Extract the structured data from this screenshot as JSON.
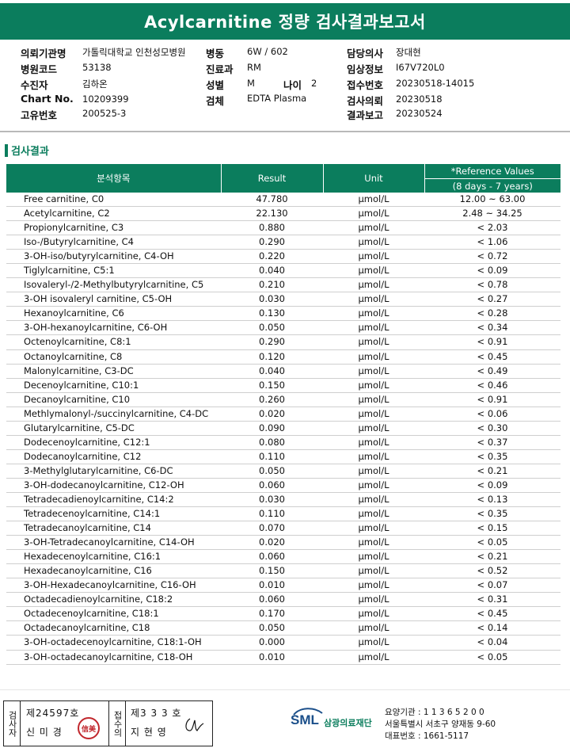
{
  "title": "Acylcarnitine 정량 검사결과보고서",
  "patient_info": [
    {
      "label": "의뢰기관명",
      "value": "가톨릭대학교 인천성모병원"
    },
    {
      "label": "병원코드",
      "value": "53138"
    },
    {
      "label": "수진자",
      "value": "김하온"
    },
    {
      "label": "Chart No.",
      "value": "10209399"
    },
    {
      "label": "고유번호",
      "value": "200525-3"
    },
    {
      "label": "병동",
      "value": "6W / 602"
    },
    {
      "label": "진료과",
      "value": "RM"
    },
    {
      "label": "성별",
      "value": "M"
    },
    {
      "label": "나이",
      "value": "2"
    },
    {
      "label": "검체",
      "value": "EDTA Plasma"
    },
    {
      "label": "담당의사",
      "value": "장대현"
    },
    {
      "label": "임상정보",
      "value": "I67V720L0"
    },
    {
      "label": "접수번호",
      "value": "20230518-14015"
    },
    {
      "label": "검사의뢰",
      "value": "20230518"
    },
    {
      "label": "결과보고",
      "value": "20230524"
    }
  ],
  "section_title": "검사결과",
  "table": {
    "headers": {
      "item": "분석항목",
      "result": "Result",
      "unit": "Unit",
      "reference": "*Reference Values",
      "reference_sub": "(8 days - 7 years)"
    },
    "rows": [
      {
        "name": "Free carnitine, C0",
        "result": "47.780",
        "unit": "μmol/L",
        "ref": "12.00 ~ 63.00"
      },
      {
        "name": "Acetylcarnitine, C2",
        "result": "22.130",
        "unit": "μmol/L",
        "ref": "2.48 ~ 34.25"
      },
      {
        "name": "Propionylcarnitine, C3",
        "result": "0.880",
        "unit": "μmol/L",
        "ref": "< 2.03"
      },
      {
        "name": "Iso-/Butyrylcarnitine, C4",
        "result": "0.290",
        "unit": "μmol/L",
        "ref": "< 1.06"
      },
      {
        "name": "3-OH-iso/butyrylcarnitine, C4-OH",
        "result": "0.220",
        "unit": "μmol/L",
        "ref": "< 0.72"
      },
      {
        "name": "Tiglylcarnitine, C5:1",
        "result": "0.040",
        "unit": "μmol/L",
        "ref": "< 0.09"
      },
      {
        "name": "Isovaleryl-/2-Methylbutyrylcarnitine, C5",
        "result": "0.210",
        "unit": "μmol/L",
        "ref": "< 0.78"
      },
      {
        "name": "3-OH isovaleryl carnitine, C5-OH",
        "result": "0.030",
        "unit": "μmol/L",
        "ref": "< 0.27"
      },
      {
        "name": "Hexanoylcarnitine, C6",
        "result": "0.130",
        "unit": "μmol/L",
        "ref": "< 0.28"
      },
      {
        "name": "3-OH-hexanoylcarnitine, C6-OH",
        "result": "0.050",
        "unit": "μmol/L",
        "ref": "< 0.34"
      },
      {
        "name": "Octenoylcarnitine, C8:1",
        "result": "0.290",
        "unit": "μmol/L",
        "ref": "< 0.91"
      },
      {
        "name": "Octanoylcarnitine, C8",
        "result": "0.120",
        "unit": "μmol/L",
        "ref": "< 0.45"
      },
      {
        "name": "Malonylcarnitine, C3-DC",
        "result": "0.040",
        "unit": "μmol/L",
        "ref": "< 0.49"
      },
      {
        "name": "Decenoylcarnitine, C10:1",
        "result": "0.150",
        "unit": "μmol/L",
        "ref": "< 0.46"
      },
      {
        "name": "Decanoylcarnitine, C10",
        "result": "0.260",
        "unit": "μmol/L",
        "ref": "< 0.91"
      },
      {
        "name": "Methlymalonyl-/succinylcarnitine, C4-DC",
        "result": "0.020",
        "unit": "μmol/L",
        "ref": "< 0.06"
      },
      {
        "name": "Glutarylcarnitine, C5-DC",
        "result": "0.090",
        "unit": "μmol/L",
        "ref": "< 0.30"
      },
      {
        "name": "Dodecenoylcarnitine, C12:1",
        "result": "0.080",
        "unit": "μmol/L",
        "ref": "< 0.37"
      },
      {
        "name": "Dodecanoylcarnitine, C12",
        "result": "0.110",
        "unit": "μmol/L",
        "ref": "< 0.35"
      },
      {
        "name": "3-Methylglutarylcarnitine, C6-DC",
        "result": "0.050",
        "unit": "μmol/L",
        "ref": "< 0.21"
      },
      {
        "name": "3-OH-dodecanoylcarnitine, C12-OH",
        "result": "0.060",
        "unit": "μmol/L",
        "ref": "< 0.09"
      },
      {
        "name": "Tetradecadienoylcarnitine, C14:2",
        "result": "0.030",
        "unit": "μmol/L",
        "ref": "< 0.13"
      },
      {
        "name": "Tetradecenoylcarnitine, C14:1",
        "result": "0.110",
        "unit": "μmol/L",
        "ref": "< 0.35"
      },
      {
        "name": "Tetradecanoylcarnitine, C14",
        "result": "0.070",
        "unit": "μmol/L",
        "ref": "< 0.15"
      },
      {
        "name": "3-OH-Tetradecanoylcarnitine, C14-OH",
        "result": "0.020",
        "unit": "μmol/L",
        "ref": "< 0.05"
      },
      {
        "name": "Hexadecenoylcarnitine, C16:1",
        "result": "0.060",
        "unit": "μmol/L",
        "ref": "< 0.21"
      },
      {
        "name": "Hexadecanoylcarnitine, C16",
        "result": "0.150",
        "unit": "μmol/L",
        "ref": "< 0.52"
      },
      {
        "name": "3-OH-Hexadecanoylcarnitine, C16-OH",
        "result": "0.010",
        "unit": "μmol/L",
        "ref": "< 0.07"
      },
      {
        "name": "Octadecadienoylcarnitine, C18:2",
        "result": "0.060",
        "unit": "μmol/L",
        "ref": "< 0.31"
      },
      {
        "name": "Octadecenoylcarnitine, C18:1",
        "result": "0.170",
        "unit": "μmol/L",
        "ref": "< 0.45"
      },
      {
        "name": "Octadecanoylcarnitine, C18",
        "result": "0.050",
        "unit": "μmol/L",
        "ref": "< 0.14"
      },
      {
        "name": "3-OH-octadecenoylcarnitine, C18:1-OH",
        "result": "0.000",
        "unit": "μmol/L",
        "ref": "< 0.04"
      },
      {
        "name": "3-OH-octadecanoylcarnitine, C18-OH",
        "result": "0.010",
        "unit": "μmol/L",
        "ref": "< 0.05"
      }
    ]
  },
  "footer": {
    "tester_label": "검사자",
    "tester_no": "제24597호",
    "tester_name": "신 미 경",
    "tester_stamp": "信美",
    "approver_label": "접수의",
    "approver_no": "제3 3 3 호",
    "approver_name": "지 현 영",
    "logo_text": "SML",
    "org_name": "삼광의료재단",
    "care_code": "요양기관 : 1 1 3 6 5 2 0 0",
    "address": "서울특별시 서초구 양재동 9-60",
    "phone": "대표번호 : 1661-5117"
  },
  "colors": {
    "brand": "#0b7d5d",
    "logo": "#1b4f8a",
    "stamp": "#c1272d"
  }
}
